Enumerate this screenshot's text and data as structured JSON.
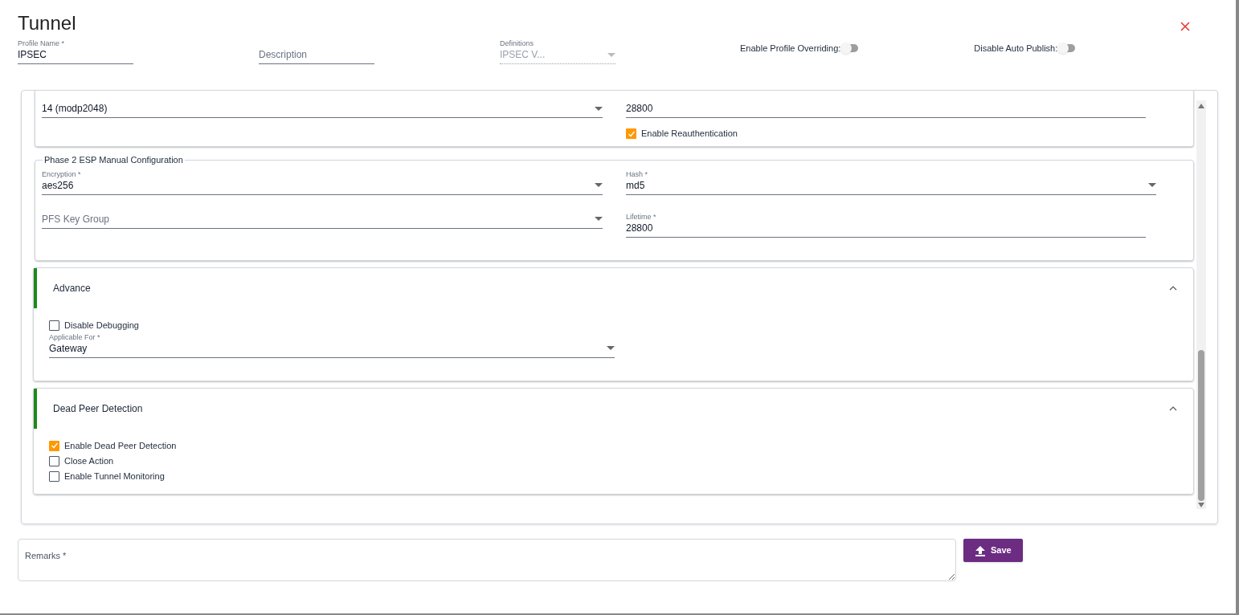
{
  "dialog": {
    "title": "Tunnel"
  },
  "header_fields": [
    {
      "kind": "text",
      "label": "Profile Name *",
      "value": "IPSEC",
      "disabled": false
    },
    {
      "kind": "text",
      "placeholder": "Description",
      "disabled": false
    },
    {
      "kind": "select",
      "label": "Definitions",
      "value": "IPSEC V...",
      "disabled": true
    }
  ],
  "toggles": [
    {
      "label": "Enable Profile Overriding:",
      "on": false
    },
    {
      "label": "Disable Auto Publish:",
      "on": false
    }
  ],
  "phase1_partial": {
    "dh_group": {
      "value": "14 (modp2048)"
    },
    "lifetime": {
      "value": "28800"
    },
    "reauth": {
      "label": "Enable Reauthentication",
      "checked": true
    }
  },
  "phase2": {
    "legend": "Phase 2 ESP Manual Configuration",
    "fields": [
      {
        "kind": "select",
        "label": "Encryption *",
        "value": "aes256"
      },
      {
        "kind": "select",
        "label": "Hash *",
        "value": "md5"
      },
      {
        "kind": "select",
        "placeholder": "PFS Key Group"
      },
      {
        "kind": "text",
        "label": "Lifetime *",
        "value": "28800"
      }
    ]
  },
  "sections": [
    {
      "title": "Advance",
      "expanded": true,
      "checkboxes": [
        {
          "label": "Disable Debugging",
          "checked": false
        }
      ],
      "select": {
        "label": "Applicable For *",
        "value": "Gateway"
      }
    },
    {
      "title": "Dead Peer Detection",
      "expanded": true,
      "checkboxes": [
        {
          "label": "Enable Dead Peer Detection",
          "checked": true
        },
        {
          "label": "Close Action",
          "checked": false
        },
        {
          "label": "Enable Tunnel Monitoring",
          "checked": false
        }
      ]
    }
  ],
  "remarks": {
    "placeholder": "Remarks *"
  },
  "save_button": {
    "label": "Save"
  }
}
